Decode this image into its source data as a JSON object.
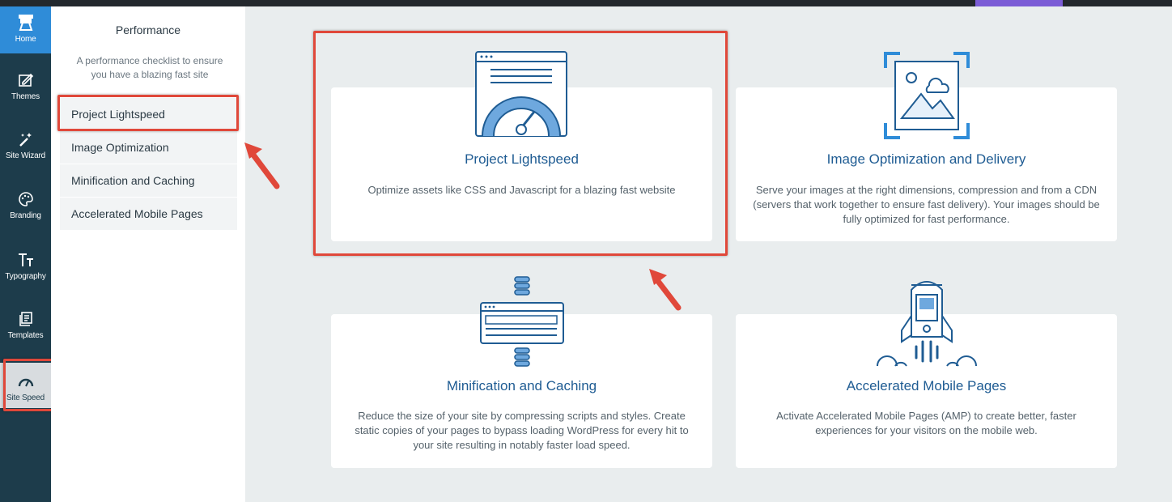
{
  "rail": {
    "items": [
      {
        "label": "Home",
        "icon": "home-icon"
      },
      {
        "label": "Themes",
        "icon": "themes-icon"
      },
      {
        "label": "Site Wizard",
        "icon": "wizard-icon"
      },
      {
        "label": "Branding",
        "icon": "palette-icon"
      },
      {
        "label": "Typography",
        "icon": "typography-icon"
      },
      {
        "label": "Templates",
        "icon": "templates-icon"
      },
      {
        "label": "Site Speed",
        "icon": "speedometer-icon"
      }
    ]
  },
  "panel": {
    "title": "Performance",
    "description": "A performance checklist to ensure you have a blazing fast site",
    "items": [
      {
        "label": "Project Lightspeed"
      },
      {
        "label": "Image Optimization"
      },
      {
        "label": "Minification and Caching"
      },
      {
        "label": "Accelerated Mobile Pages"
      }
    ]
  },
  "cards": [
    {
      "title": "Project Lightspeed",
      "description": "Optimize assets like CSS and Javascript for a blazing fast website"
    },
    {
      "title": "Image Optimization and Delivery",
      "description": "Serve your images at the right dimensions, compression and from a CDN (servers that work together to ensure fast delivery). Your images should be fully optimized for fast performance."
    },
    {
      "title": "Minification and Caching",
      "description": "Reduce the size of your site by compressing scripts and styles. Create static copies of your pages to bypass loading WordPress for every hit to your site resulting in notably faster load speed."
    },
    {
      "title": "Accelerated Mobile Pages",
      "description": "Activate Accelerated Mobile Pages (AMP) to create better, faster experiences for your visitors on the mobile web."
    }
  ],
  "colors": {
    "rail_bg": "#1d3c4b",
    "active_blue": "#2f8cd8",
    "card_title": "#1f5c93",
    "annotation_red": "#e0483a",
    "illustration_stroke": "#1f5c93",
    "illustration_fill": "#6ea8de"
  }
}
